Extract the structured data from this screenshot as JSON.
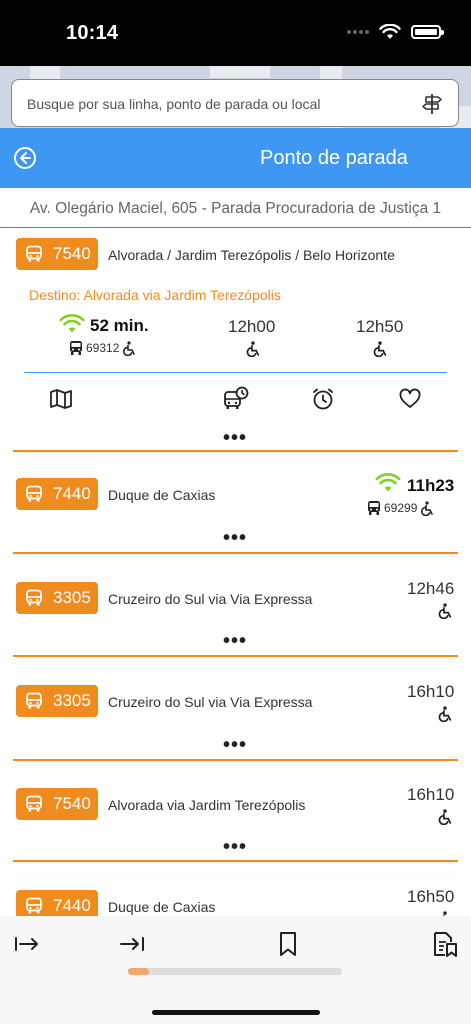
{
  "status": {
    "time": "10:14"
  },
  "search": {
    "placeholder": "Busque por sua linha, ponto de parada ou local",
    "icon": "signpost-icon"
  },
  "header": {
    "title": "Ponto de parada"
  },
  "stop": {
    "name": "Av. Olegário Maciel, 605 - Parada Procuradoria de Justiça 1"
  },
  "colors": {
    "accent": "#f08c1e",
    "header": "#3f97f4",
    "realtime": "#7ed321"
  },
  "cards": [
    {
      "line": "7540",
      "route": "Alvorada / Jardim Terezópolis / Belo Horizonte",
      "destination": "Destino: Alvorada via Jardim Terezópolis",
      "realtime": "52 min.",
      "vehicle": "69312",
      "times": [
        "12h00",
        "12h50"
      ]
    },
    {
      "line": "7440",
      "route": "Duque de Caxias",
      "time": "11h23",
      "vehicle": "69299"
    },
    {
      "line": "3305",
      "route": "Cruzeiro do Sul via Via Expressa",
      "time": "12h46"
    },
    {
      "line": "3305",
      "route": "Cruzeiro do Sul via Via Expressa",
      "time": "16h10"
    },
    {
      "line": "7540",
      "route": "Alvorada via Jardim Terezópolis",
      "time": "16h10"
    },
    {
      "line": "7440",
      "route": "Duque de Caxias",
      "time": "16h50"
    }
  ],
  "more_label": "•••",
  "progress": {
    "fraction": 0.1
  }
}
